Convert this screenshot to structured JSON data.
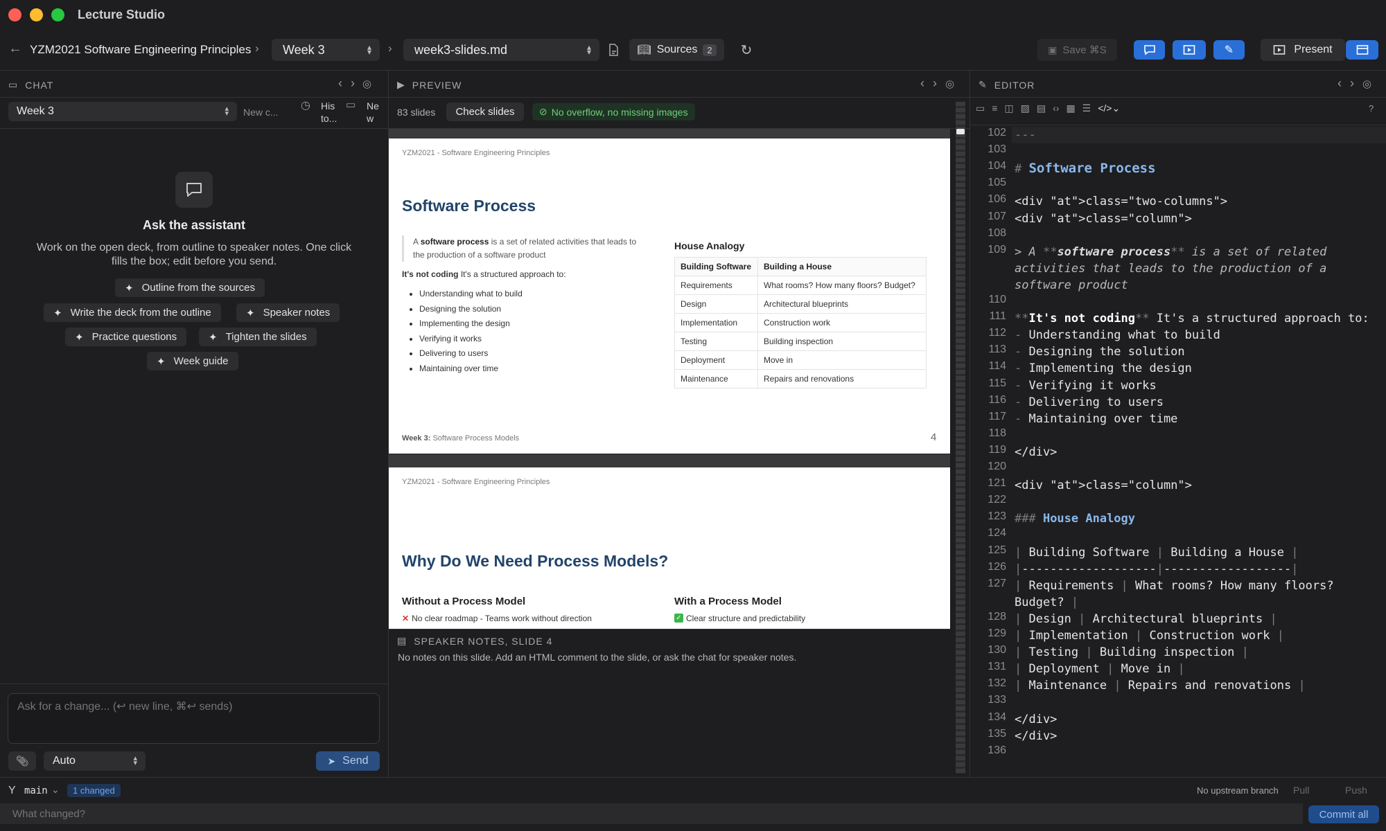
{
  "window": {
    "title": "Lecture Studio"
  },
  "toolbar": {
    "course": "YZM2021 Software Engineering Principles",
    "week": "Week 3",
    "file": "week3-slides.md",
    "sources_label": "Sources",
    "sources_count": "2",
    "save_label": "Save ⌘S",
    "present_label": "Present"
  },
  "chat": {
    "header": "CHAT",
    "session": "Week 3",
    "new_chat": "New c...",
    "history": "His to...",
    "new": "Ne w",
    "empty_title": "Ask the assistant",
    "empty_desc": "Work on the open deck, from outline to speaker notes. One click fills the box; edit before you send.",
    "suggestions": [
      "Outline from the sources",
      "Write the deck from the outline",
      "Speaker notes",
      "Practice questions",
      "Tighten the slides",
      "Week guide"
    ],
    "input_placeholder": "Ask for a change... (↩ new line, ⌘↩ sends)",
    "mode": "Auto",
    "send": "Send"
  },
  "preview": {
    "header": "PREVIEW",
    "count": "83 slides",
    "check": "Check slides",
    "status": "No overflow, no missing images",
    "slide4": {
      "course": "YZM2021 - Software Engineering Principles",
      "title": "Software Process",
      "quote_pre": "A ",
      "quote_bold": "software process",
      "quote_post": " is a set of related activities that leads to the production of a software product",
      "lead_bold": "It's not coding",
      "lead_rest": " It's a structured approach to:",
      "bullets": [
        "Understanding what to build",
        "Designing the solution",
        "Implementing the design",
        "Verifying it works",
        "Delivering to users",
        "Maintaining over time"
      ],
      "table_title": "House Analogy",
      "table_head": [
        "Building Software",
        "Building a House"
      ],
      "table_rows": [
        [
          "Requirements",
          "What rooms? How many floors? Budget?"
        ],
        [
          "Design",
          "Architectural blueprints"
        ],
        [
          "Implementation",
          "Construction work"
        ],
        [
          "Testing",
          "Building inspection"
        ],
        [
          "Deployment",
          "Move in"
        ],
        [
          "Maintenance",
          "Repairs and renovations"
        ]
      ],
      "footer_week": "Week 3:",
      "footer_title": "Software Process Models",
      "page": "4"
    },
    "slide5": {
      "course": "YZM2021 - Software Engineering Principles",
      "title": "Why Do We Need Process Models?",
      "left_title": "Without a Process Model",
      "left_item": "No clear roadmap - Teams work without direction",
      "right_title": "With a Process Model",
      "right_item": "Clear structure and predictability"
    },
    "notes_header": "SPEAKER NOTES, SLIDE 4",
    "notes_body": "No notes on this slide. Add an HTML comment to the slide, or ask the chat for speaker notes."
  },
  "editor": {
    "header": "EDITOR",
    "lines": [
      {
        "n": "102",
        "t": "---"
      },
      {
        "n": "103",
        "t": ""
      },
      {
        "n": "104",
        "t": "# Software Process"
      },
      {
        "n": "105",
        "t": ""
      },
      {
        "n": "106",
        "t": "<div class=\"two-columns\">"
      },
      {
        "n": "107",
        "t": "<div class=\"column\">"
      },
      {
        "n": "108",
        "t": ""
      },
      {
        "n": "109",
        "t": "> A **software process** is a set of related activities that leads to the production of a software product"
      },
      {
        "n": "110",
        "t": ""
      },
      {
        "n": "111",
        "t": "**It's not coding** It's a structured approach to:"
      },
      {
        "n": "112",
        "t": "- Understanding what to build"
      },
      {
        "n": "113",
        "t": "- Designing the solution"
      },
      {
        "n": "114",
        "t": "- Implementing the design"
      },
      {
        "n": "115",
        "t": "- Verifying it works"
      },
      {
        "n": "116",
        "t": "- Delivering to users"
      },
      {
        "n": "117",
        "t": "- Maintaining over time"
      },
      {
        "n": "118",
        "t": ""
      },
      {
        "n": "119",
        "t": "</div>"
      },
      {
        "n": "120",
        "t": ""
      },
      {
        "n": "121",
        "t": "<div class=\"column\">"
      },
      {
        "n": "122",
        "t": ""
      },
      {
        "n": "123",
        "t": "### House Analogy"
      },
      {
        "n": "124",
        "t": ""
      },
      {
        "n": "125",
        "t": "| Building Software | Building a House |"
      },
      {
        "n": "126",
        "t": "|-------------------|------------------|"
      },
      {
        "n": "127",
        "t": "| Requirements | What rooms? How many floors? Budget? |"
      },
      {
        "n": "128",
        "t": "| Design | Architectural blueprints |"
      },
      {
        "n": "129",
        "t": "| Implementation | Construction work |"
      },
      {
        "n": "130",
        "t": "| Testing | Building inspection |"
      },
      {
        "n": "131",
        "t": "| Deployment | Move in |"
      },
      {
        "n": "132",
        "t": "| Maintenance | Repairs and renovations |"
      },
      {
        "n": "133",
        "t": ""
      },
      {
        "n": "134",
        "t": "</div>"
      },
      {
        "n": "135",
        "t": "</div>"
      },
      {
        "n": "136",
        "t": ""
      }
    ]
  },
  "statusbar": {
    "branch": "main",
    "changed": "1 changed",
    "upstream": "No upstream branch",
    "pull": "Pull",
    "push": "Push",
    "commit_placeholder": "What changed?",
    "commit": "Commit all"
  },
  "colors": {
    "accent": "#2a6fd8",
    "success": "#5fc06b",
    "slide_title": "#22446a"
  }
}
